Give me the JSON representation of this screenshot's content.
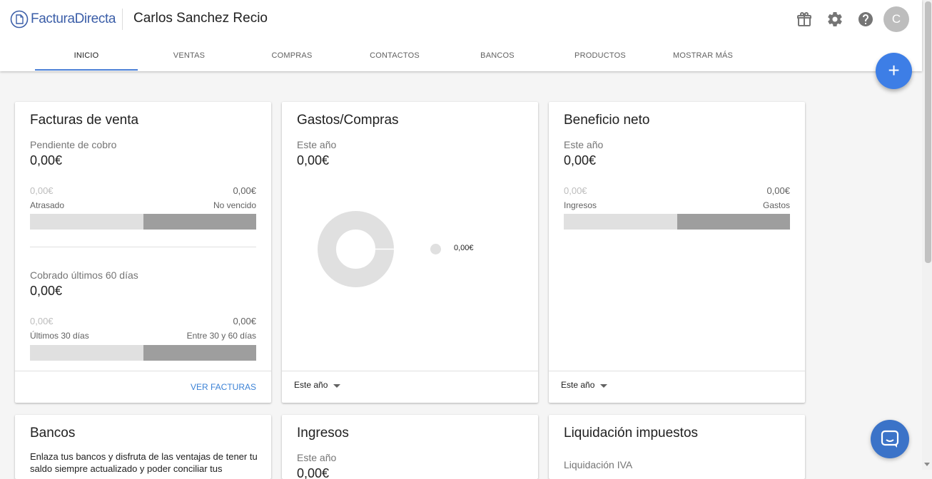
{
  "header": {
    "logo_text": "FacturaDirecta",
    "company_name": "Carlos Sanchez Recio",
    "icons": [
      "gift-icon",
      "gear-icon",
      "help-icon"
    ],
    "avatar_letter": "C"
  },
  "nav": {
    "tabs": [
      {
        "label": "INICIO",
        "active": true
      },
      {
        "label": "VENTAS",
        "active": false
      },
      {
        "label": "COMPRAS",
        "active": false
      },
      {
        "label": "CONTACTOS",
        "active": false
      },
      {
        "label": "BANCOS",
        "active": false
      },
      {
        "label": "PRODUCTOS",
        "active": false
      },
      {
        "label": "MOSTRAR MÁS",
        "active": false
      }
    ]
  },
  "fab": {
    "label": "+"
  },
  "colors": {
    "accent": "#3d7ee6",
    "link": "#3b82d6",
    "tab_underline": "#4a7fd6"
  },
  "cards": {
    "facturas": {
      "title": "Facturas de venta",
      "pending_label": "Pendiente de cobro",
      "pending_amount": "0,00€",
      "bar1_left_value": "0,00€",
      "bar1_right_value": "0,00€",
      "bar1_left_label": "Atrasado",
      "bar1_right_label": "No vencido",
      "collected_label": "Cobrado últimos 60 días",
      "collected_amount": "0,00€",
      "bar2_left_value": "0,00€",
      "bar2_right_value": "0,00€",
      "bar2_left_label": "Últimos 30 días",
      "bar2_right_label": "Entre 30 y 60 días",
      "footer_link": "VER FACTURAS"
    },
    "gastos": {
      "title": "Gastos/Compras",
      "period_label": "Este año",
      "amount": "0,00€",
      "legend_value": "0,00€",
      "footer_select": "Este año"
    },
    "beneficio": {
      "title": "Beneficio neto",
      "period_label": "Este año",
      "amount": "0,00€",
      "left_value": "0,00€",
      "right_value": "0,00€",
      "left_label": "Ingresos",
      "right_label": "Gastos",
      "footer_select": "Este año"
    },
    "bancos": {
      "title": "Bancos",
      "text": "Enlaza tus bancos y disfruta de las ventajas de tener tu saldo siempre actualizado y poder conciliar tus"
    },
    "ingresos": {
      "title": "Ingresos",
      "period_label": "Este año",
      "amount": "0,00€"
    },
    "impuestos": {
      "title": "Liquidación impuestos",
      "sub_label": "Liquidación IVA"
    }
  }
}
